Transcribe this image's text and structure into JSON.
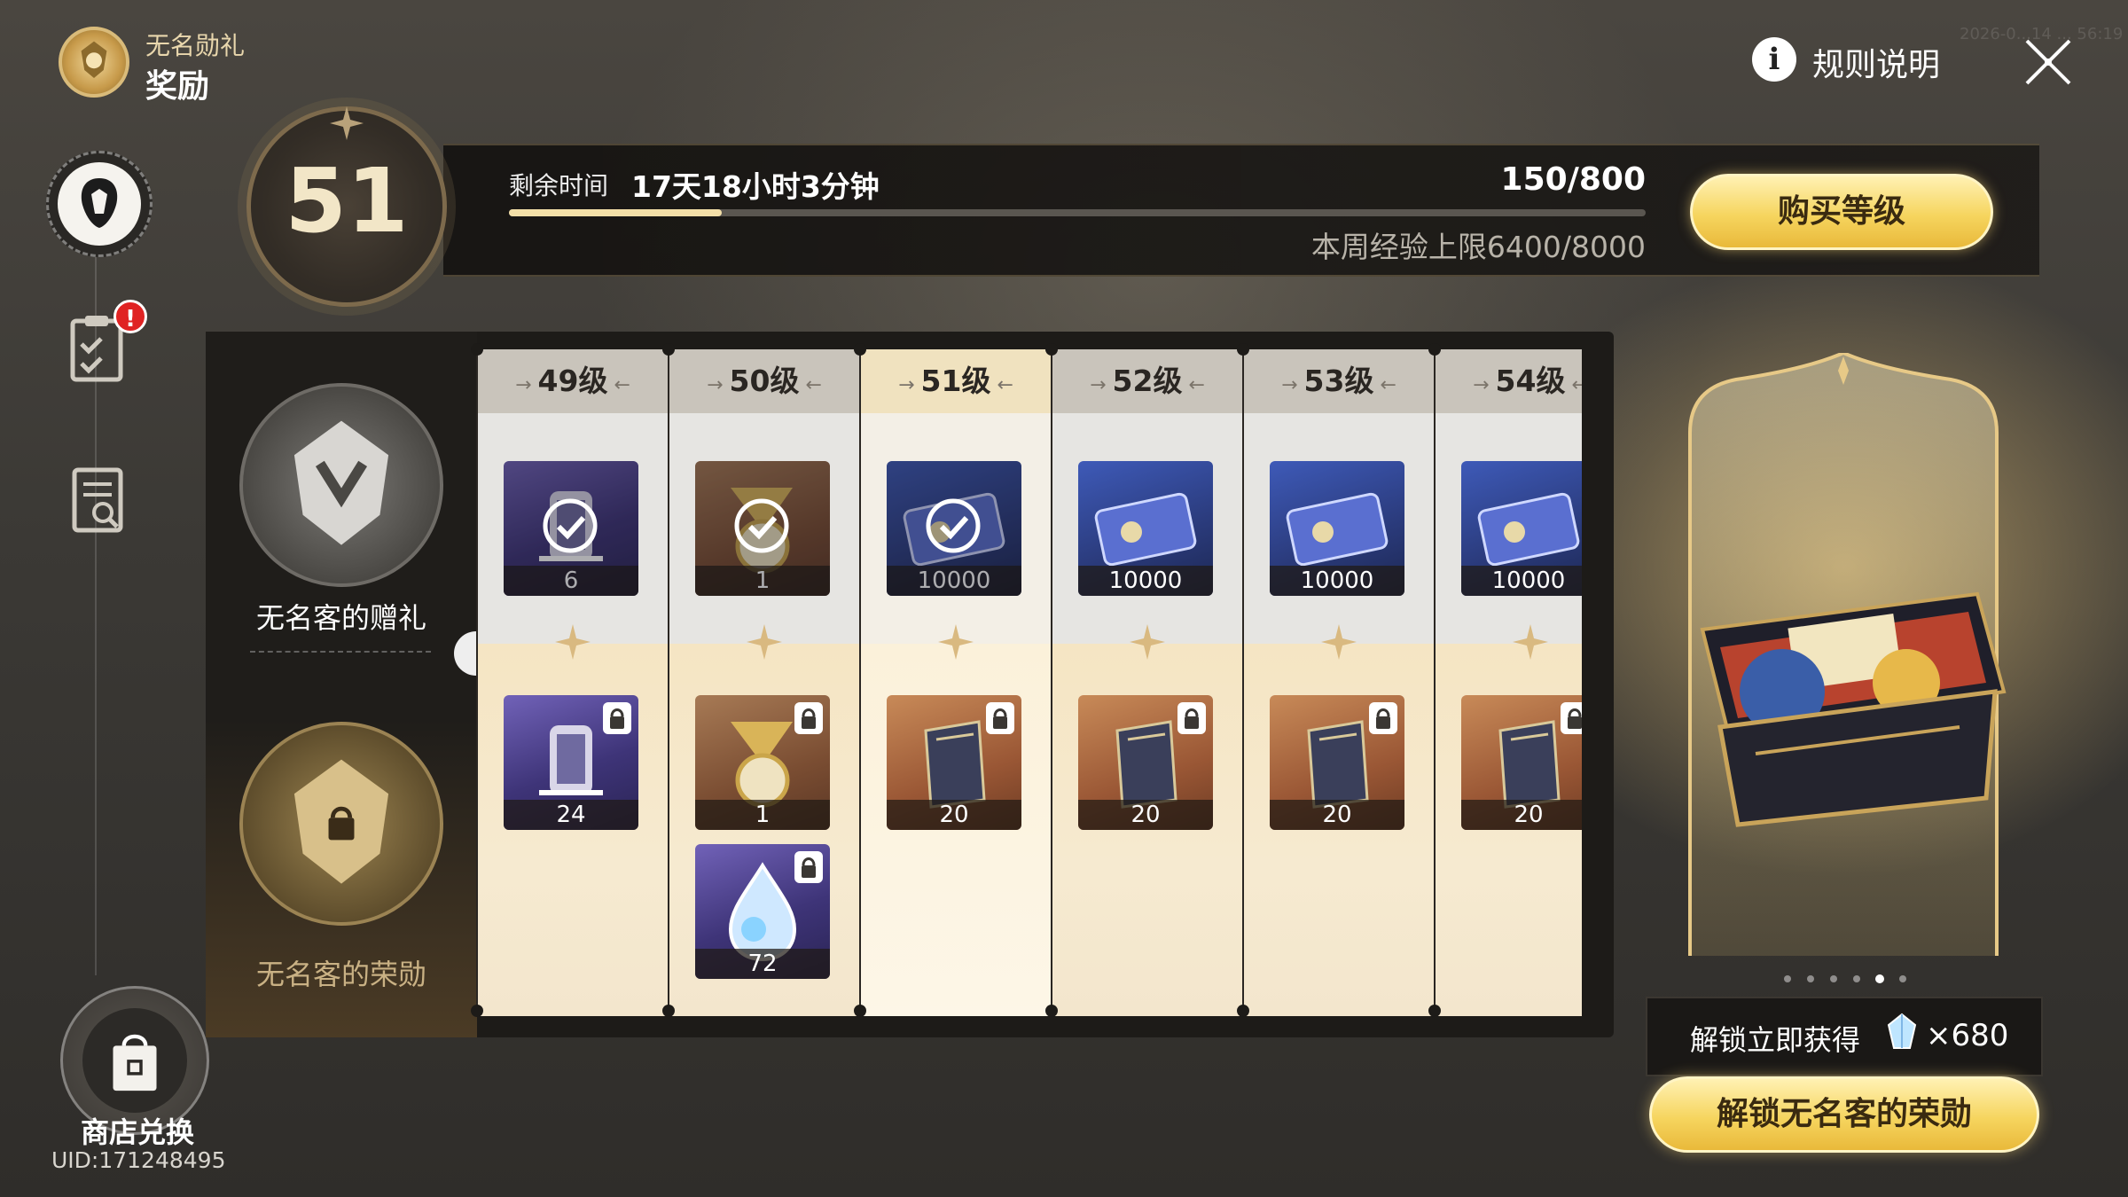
{
  "header": {
    "event_name": "无名勋礼",
    "page_title": "奖励",
    "rules_label": "规则说明",
    "timestamp": "2026-0...14 ... 56:19"
  },
  "sidebar": {
    "mission_badge": "!",
    "shop_label": "商店兑换",
    "uid": "UID:171248495"
  },
  "level": {
    "current": "51",
    "time_label": "剩余时间",
    "time_value": "17天18小时3分钟",
    "exp": "150/800",
    "exp_progress": 0.1875,
    "weekly_cap": "本周经验上限6400/8000",
    "buy_label": "购买等级"
  },
  "tracks": {
    "free_label": "无名客的赠礼",
    "paid_label": "无名客的荣勋"
  },
  "columns": [
    {
      "label": "49级",
      "free": {
        "qty": "6",
        "bg": "purple",
        "icon": "relic-lantern-icon",
        "claimed": true
      },
      "paid": [
        {
          "qty": "24",
          "bg": "purple",
          "icon": "relic-lantern-icon",
          "locked": true
        }
      ]
    },
    {
      "label": "50级",
      "free": {
        "qty": "1",
        "bg": "brown",
        "icon": "trumpet-watch-icon",
        "claimed": true
      },
      "paid": [
        {
          "qty": "1",
          "bg": "brown",
          "icon": "trumpet-watch-icon",
          "locked": true
        },
        {
          "qty": "72",
          "bg": "purple",
          "icon": "fuel-drop-icon",
          "locked": true
        }
      ]
    },
    {
      "label": "51级",
      "current": true,
      "free": {
        "qty": "10000",
        "bg": "navy",
        "icon": "credit-card-icon",
        "claimed": true
      },
      "paid": [
        {
          "qty": "20",
          "bg": "rust",
          "icon": "exp-book-icon",
          "locked": true
        }
      ]
    },
    {
      "label": "52级",
      "free": {
        "qty": "10000",
        "bg": "navy",
        "icon": "credit-card-icon",
        "claimed": false
      },
      "paid": [
        {
          "qty": "20",
          "bg": "rust",
          "icon": "exp-book-icon",
          "locked": true
        }
      ]
    },
    {
      "label": "53级",
      "free": {
        "qty": "10000",
        "bg": "navy",
        "icon": "credit-card-icon",
        "claimed": false
      },
      "paid": [
        {
          "qty": "20",
          "bg": "rust",
          "icon": "exp-book-icon",
          "locked": true
        }
      ]
    },
    {
      "label": "54级",
      "free": {
        "qty": "10000",
        "bg": "navy",
        "icon": "credit-card-icon",
        "claimed": false
      },
      "paid": [
        {
          "qty": "20",
          "bg": "rust",
          "icon": "exp-book-icon",
          "locked": true
        }
      ]
    }
  ],
  "preview": {
    "unlock_text": "解锁立即获得",
    "unlock_count": "×680",
    "unlock_button": "解锁无名客的荣勋",
    "page_count": 6,
    "active_page": 5
  },
  "colors": {
    "gold": "#f6d55f",
    "accent_cream": "#f3dfa8",
    "badge_red": "#e02323"
  }
}
